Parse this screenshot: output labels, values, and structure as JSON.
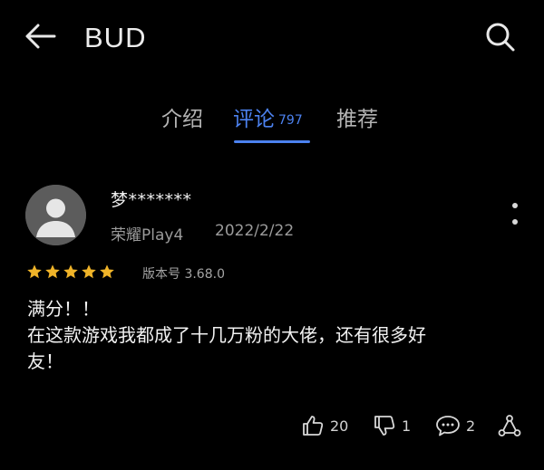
{
  "header": {
    "back_icon": "arrow-left-icon",
    "title": "BUD",
    "search_icon": "search-icon"
  },
  "tabs": [
    {
      "label": "介绍",
      "active": false
    },
    {
      "label": "评论",
      "count": "797",
      "active": true
    },
    {
      "label": "推荐",
      "active": false
    }
  ],
  "review": {
    "user_name": "梦*******",
    "device": "荣耀Play4",
    "date": "2022/2/22",
    "rating": 5,
    "version": "版本号 3.68.0",
    "text": "满分！！\n在这款游戏我都成了十几万粉的大佬，还有很多好\n友！",
    "actions": {
      "likes": "20",
      "dislikes": "1",
      "comments": "2"
    }
  },
  "colors": {
    "accent": "#4c82f0",
    "star": "#f0b429",
    "background": "#000000"
  }
}
